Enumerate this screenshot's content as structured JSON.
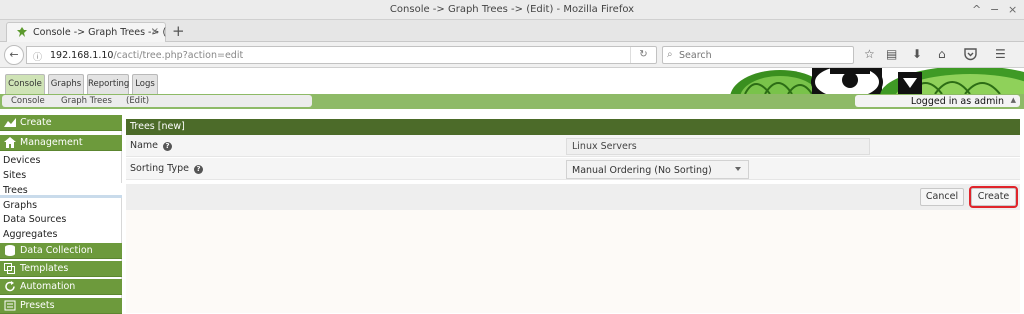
{
  "window": {
    "title": "Console -> Graph Trees -> (Edit) - Mozilla Firefox",
    "controls": [
      "^",
      "−",
      "×"
    ]
  },
  "browser": {
    "tab_title": "Console -> Graph Trees -> (",
    "new_tab": "+",
    "url_host": "192.168.1.10",
    "url_path": "/cacti/tree.php?action=edit",
    "search_placeholder": "Search"
  },
  "cacti": {
    "tabs": [
      "Console",
      "Graphs",
      "Reporting",
      "Logs"
    ],
    "active_tab": "Console",
    "breadcrumbs": [
      "Console",
      "Graph Trees",
      "(Edit)"
    ],
    "login_status": "Logged in as admin"
  },
  "sidebar": {
    "sections": [
      {
        "label": "Create",
        "icon": "chart-icon"
      },
      {
        "label": "Management",
        "icon": "home-icon"
      },
      {
        "label": "Data Collection",
        "icon": "database-icon"
      },
      {
        "label": "Templates",
        "icon": "copy-icon"
      },
      {
        "label": "Automation",
        "icon": "refresh-icon"
      },
      {
        "label": "Presets",
        "icon": "list-icon"
      }
    ],
    "items": [
      "Devices",
      "Sites",
      "Trees",
      "Graphs",
      "Data Sources",
      "Aggregates"
    ],
    "selected_item": "Trees"
  },
  "form": {
    "header": "Trees [new]",
    "name_label": "Name",
    "name_value": "Linux Servers",
    "sorting_label": "Sorting Type",
    "sorting_value": "Manual Ordering (No Sorting)",
    "cancel_label": "Cancel",
    "create_label": "Create"
  },
  "colors": {
    "cacti_green": "#6d9a3c",
    "header_dark": "#4c6b29",
    "highlight_red": "#e0242b"
  }
}
